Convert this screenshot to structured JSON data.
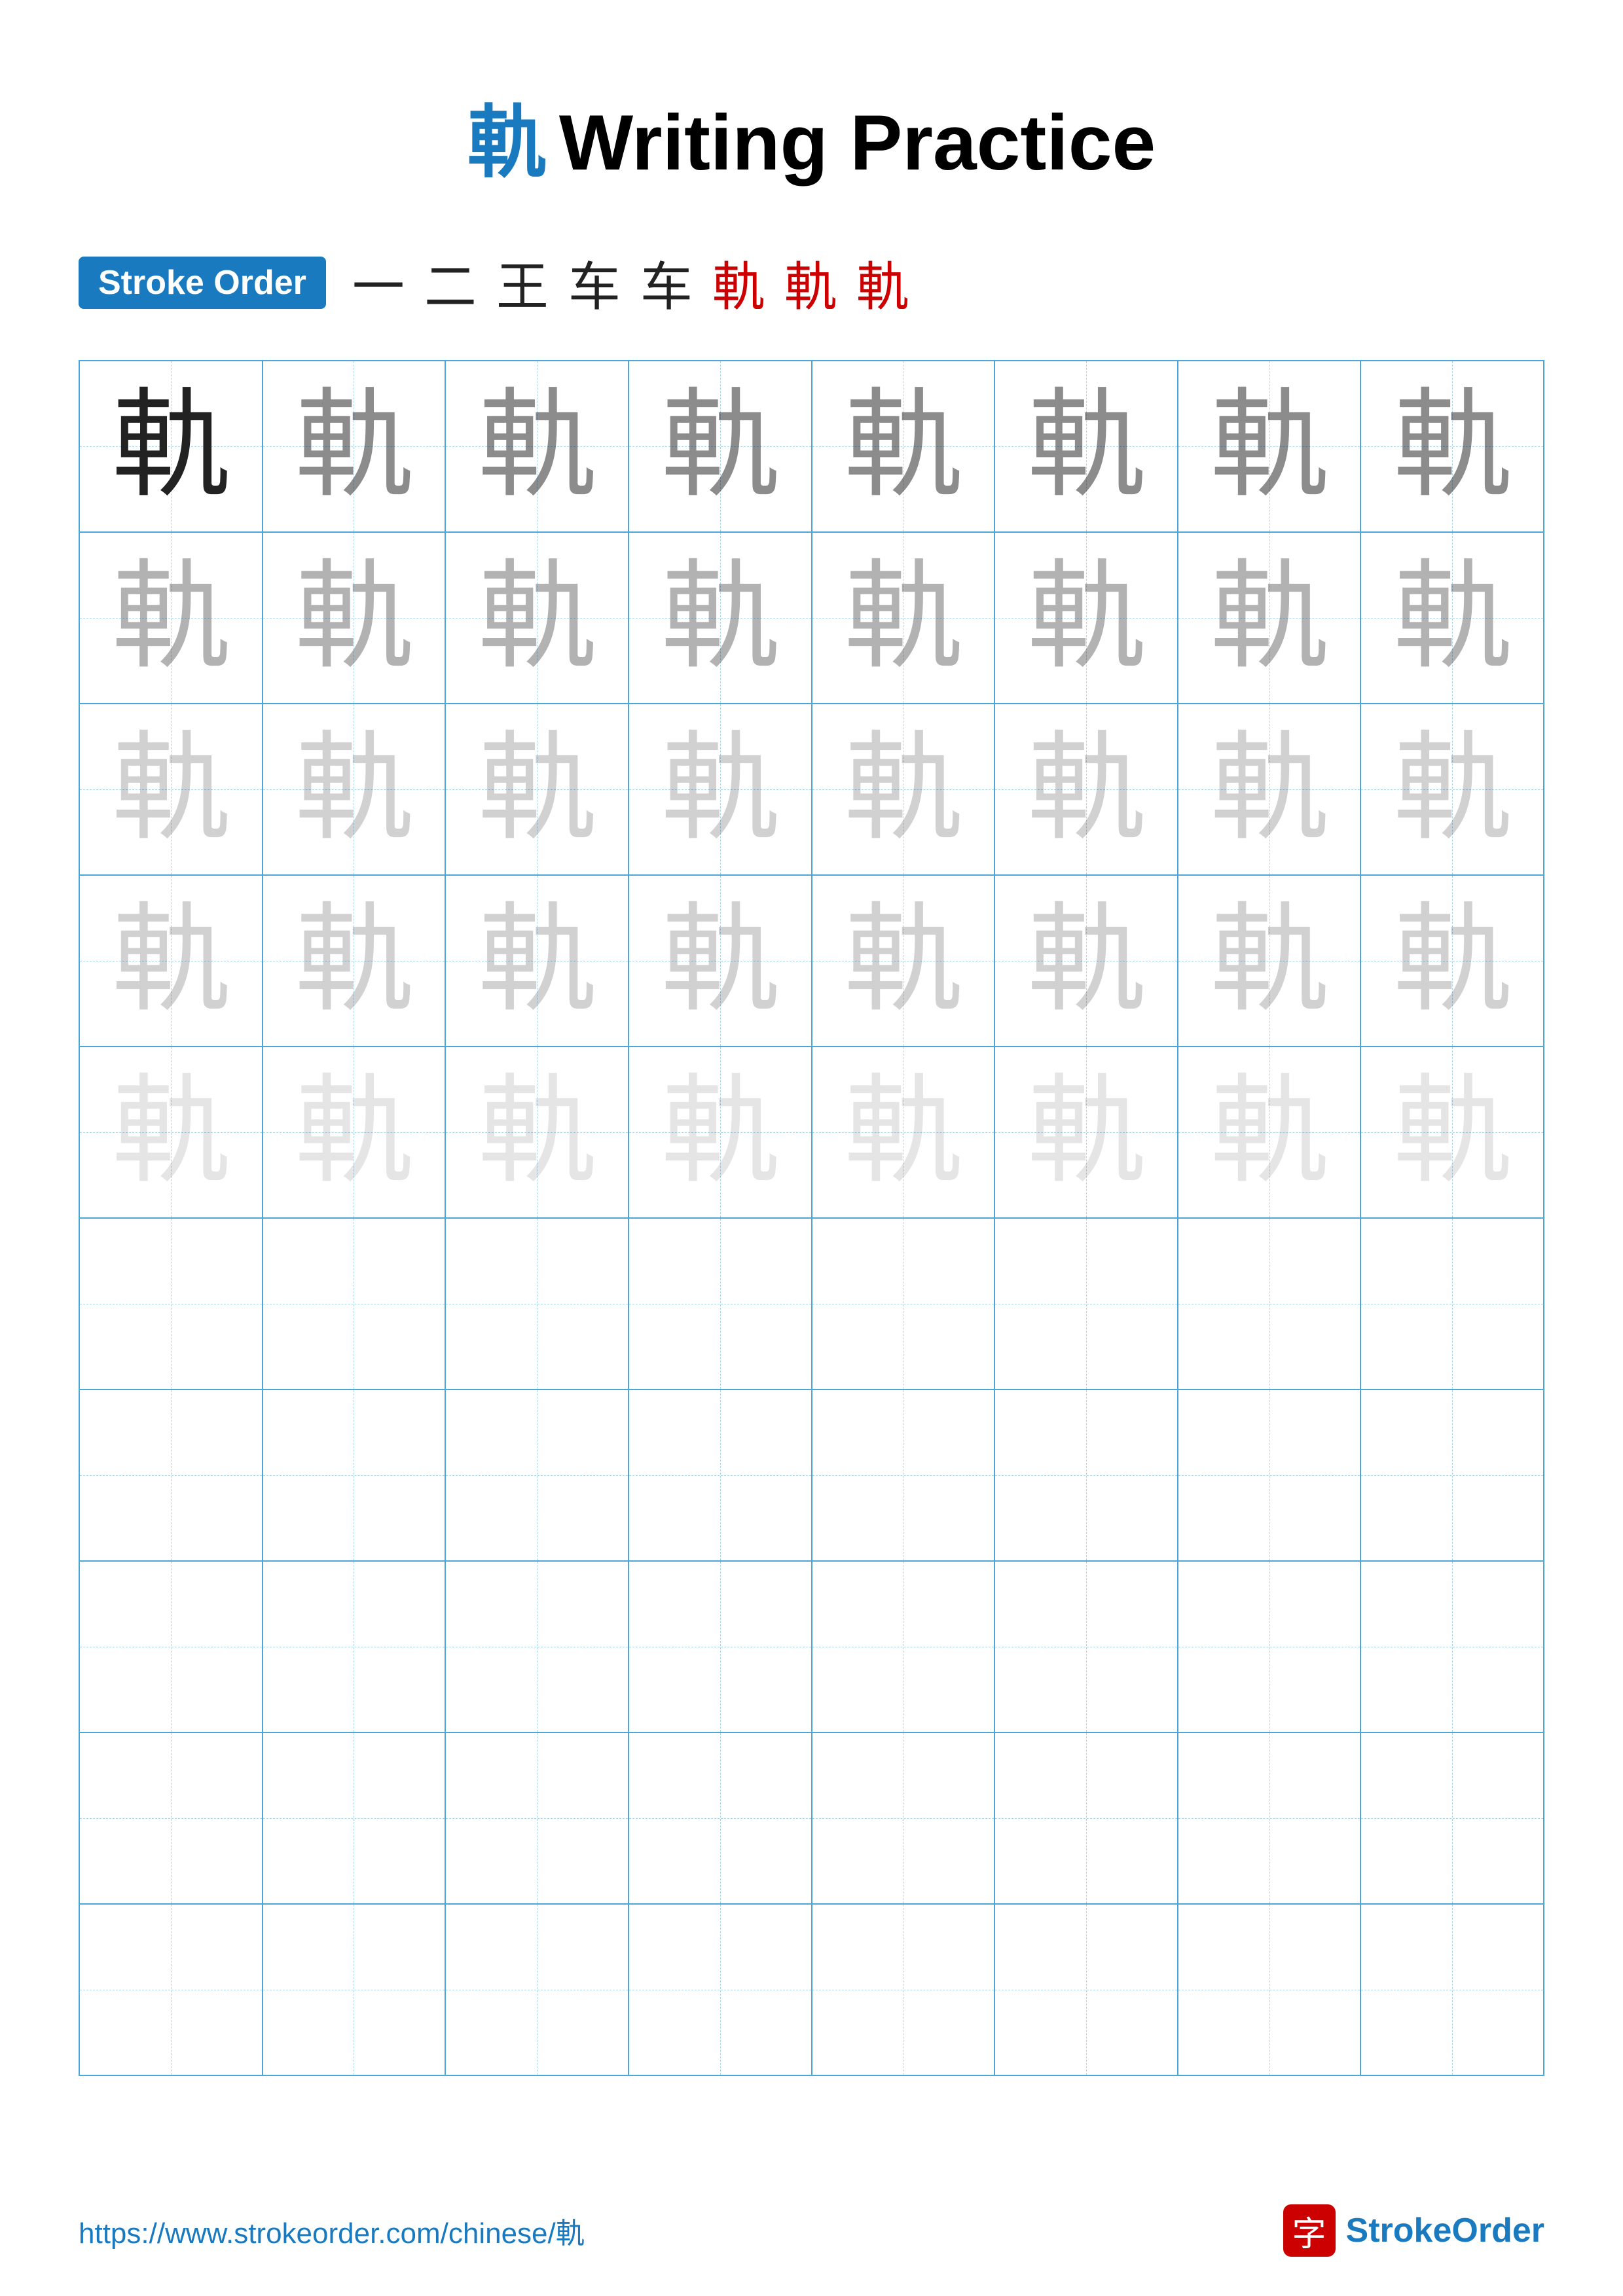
{
  "title": {
    "char": "軌",
    "text": "Writing Practice"
  },
  "stroke_order": {
    "badge_label": "Stroke Order",
    "strokes": [
      "一",
      "二",
      "王",
      "车",
      "车",
      "軌",
      "軌",
      "軌"
    ]
  },
  "grid": {
    "rows": 10,
    "cols": 8,
    "character": "軌",
    "practice_char": "軌"
  },
  "footer": {
    "url": "https://www.strokeorder.com/chinese/軌",
    "brand_char": "字",
    "brand_name_part1": "Stroke",
    "brand_name_part2": "Order"
  }
}
